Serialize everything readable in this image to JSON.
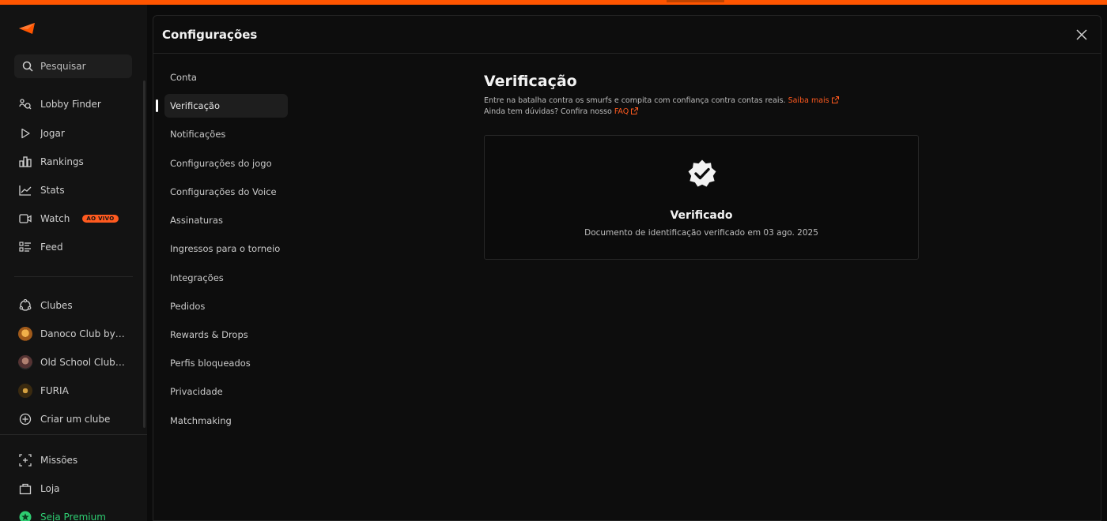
{
  "app": {
    "accent_color": "#ff5500",
    "sidebar": {
      "search_label": "Pesquisar",
      "nav": [
        {
          "label": "Lobby Finder",
          "icon": "lobby-finder-icon"
        },
        {
          "label": "Jogar",
          "icon": "play-icon"
        },
        {
          "label": "Rankings",
          "icon": "rankings-icon"
        },
        {
          "label": "Stats",
          "icon": "stats-icon"
        },
        {
          "label": "Watch",
          "icon": "watch-icon",
          "badge": "AO VIVO"
        },
        {
          "label": "Feed",
          "icon": "feed-icon"
        }
      ],
      "clubs": [
        {
          "label": "Clubes",
          "icon": "clubs-icon"
        },
        {
          "label": "Danoco Club by K...",
          "icon": "club-avatar"
        },
        {
          "label": "Old School Club by...",
          "icon": "club-avatar"
        },
        {
          "label": "FURIA",
          "icon": "club-avatar"
        },
        {
          "label": "Criar um clube",
          "icon": "plus-circle-icon"
        }
      ],
      "bottom": [
        {
          "label": "Missões",
          "icon": "missions-icon"
        },
        {
          "label": "Loja",
          "icon": "shop-icon"
        },
        {
          "label": "Seja Premium",
          "icon": "premium-icon",
          "color": "#2ecc71"
        }
      ]
    }
  },
  "settings": {
    "title": "Configurações",
    "nav": [
      {
        "label": "Conta"
      },
      {
        "label": "Verificação",
        "active": true
      },
      {
        "label": "Notificações"
      },
      {
        "label": "Configurações do jogo"
      },
      {
        "label": "Configurações do Voice"
      },
      {
        "label": "Assinaturas"
      },
      {
        "label": "Ingressos para o torneio"
      },
      {
        "label": "Integrações"
      },
      {
        "label": "Pedidos"
      },
      {
        "label": "Rewards & Drops"
      },
      {
        "label": "Perfis bloqueados"
      },
      {
        "label": "Privacidade"
      },
      {
        "label": "Matchmaking"
      }
    ]
  },
  "verification": {
    "title": "Verificação",
    "line1": "Entre na batalha contra os smurfs e compita com confiança contra contas reais.",
    "line1_link": "Saiba mais",
    "line2": "Ainda tem dúvidas? Confira nosso",
    "line2_link": "FAQ",
    "card": {
      "status": "Verificado",
      "description": "Documento de identificação verificado em 03 ago. 2025"
    }
  }
}
